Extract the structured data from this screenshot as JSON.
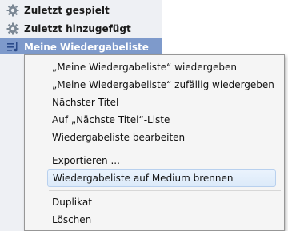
{
  "sidebar": {
    "items": [
      {
        "label": "Zuletzt gespielt",
        "icon": "gear-icon",
        "selected": false
      },
      {
        "label": "Zuletzt hinzugefügt",
        "icon": "gear-icon",
        "selected": false
      },
      {
        "label": "Meine Wiedergabeliste",
        "icon": "playlist-icon",
        "selected": true
      }
    ]
  },
  "context_menu": {
    "group1": [
      "„Meine Wiedergabeliste“ wiedergeben",
      "„Meine Wiedergabeliste“ zufällig wiedergeben",
      "Nächster Titel",
      "Auf „Nächste Titel“-Liste",
      "Wiedergabeliste bearbeiten"
    ],
    "group2": [
      "Exportieren ...",
      "Wiedergabeliste auf Medium brennen"
    ],
    "group3": [
      "Duplikat",
      "Löschen"
    ],
    "hovered_item": "Wiedergabeliste auf Medium brennen"
  },
  "colors": {
    "selection": "#7e9acb",
    "sidebar_bg": "#eef0f4",
    "menu_bg": "#f5f5f5"
  }
}
